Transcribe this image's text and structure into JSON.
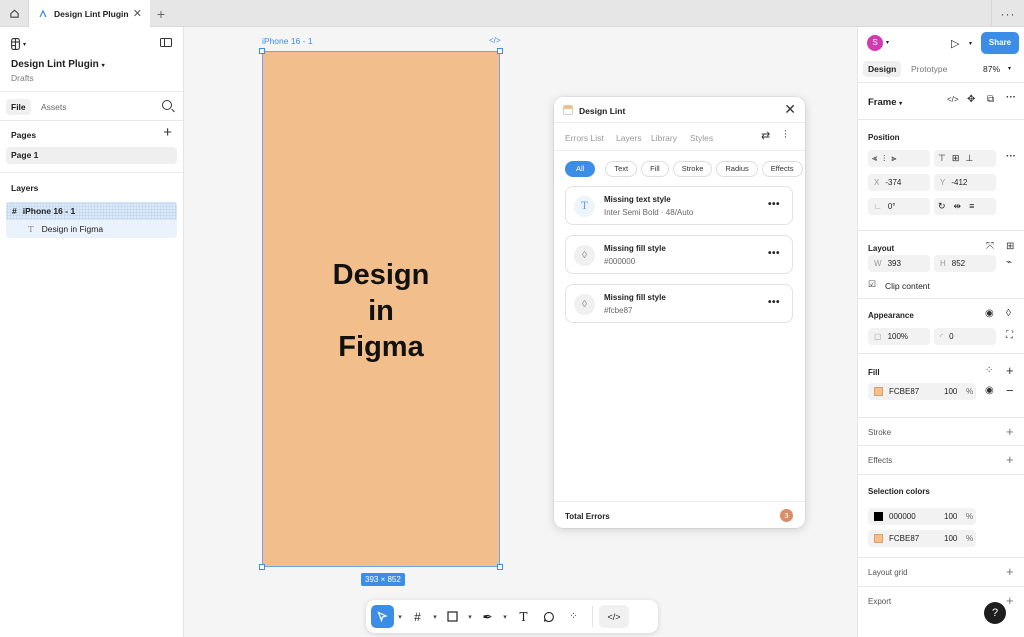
{
  "tabs": {
    "file_tab_label": "Design Lint Plugin",
    "new_tab": "+",
    "more": "···"
  },
  "left": {
    "project_name": "Design Lint Plugin",
    "project_sub": "Drafts",
    "tab_file": "File",
    "tab_assets": "Assets",
    "pages_title": "Pages",
    "page_item": "Page 1",
    "layers_title": "Layers",
    "layer_frame": "iPhone 16 - 1",
    "layer_text": "Design in Figma"
  },
  "canvas": {
    "frame_label": "iPhone 16 - 1",
    "frame_code": "</>",
    "title_line1": "Design",
    "title_line2": "in",
    "title_line3": "Figma",
    "dim_badge": "393 × 852",
    "frame_fill": "#f2bf8c"
  },
  "plugin": {
    "title": "Design Lint",
    "nav": [
      "Errors List",
      "Layers",
      "Library",
      "Styles"
    ],
    "chips": [
      "All",
      "Text",
      "Fill",
      "Stroke",
      "Radius",
      "Effects"
    ],
    "errors": [
      {
        "title": "Missing text style",
        "detail": "Inter Semi Bold · 48/Auto",
        "icon": "T"
      },
      {
        "title": "Missing fill style",
        "detail": "#000000",
        "icon": "◊"
      },
      {
        "title": "Missing fill style",
        "detail": "#fcbe87",
        "icon": "◊"
      }
    ],
    "total_label": "Total Errors",
    "total_count": "3"
  },
  "right": {
    "avatar": "S",
    "share": "Share",
    "tab_design": "Design",
    "tab_prototype": "Prototype",
    "zoom": "87%",
    "frame_title": "Frame",
    "position_title": "Position",
    "x_label": "X",
    "x_value": "-374",
    "y_label": "Y",
    "y_value": "-412",
    "rotation": "0°",
    "layout_title": "Layout",
    "w_label": "W",
    "w_value": "393",
    "h_label": "H",
    "h_value": "852",
    "clip_content": "Clip content",
    "appearance_title": "Appearance",
    "opacity": "100%",
    "radius": "0",
    "fill_title": "Fill",
    "fill_hex": "FCBE87",
    "fill_opacity": "100",
    "percent": "%",
    "stroke_title": "Stroke",
    "effects_title": "Effects",
    "selection_colors_title": "Selection colors",
    "sel_color1": "000000",
    "sel_color1_op": "100",
    "sel_color2": "FCBE87",
    "sel_color2_op": "100",
    "layout_grid_title": "Layout grid",
    "export_title": "Export",
    "help": "?"
  }
}
